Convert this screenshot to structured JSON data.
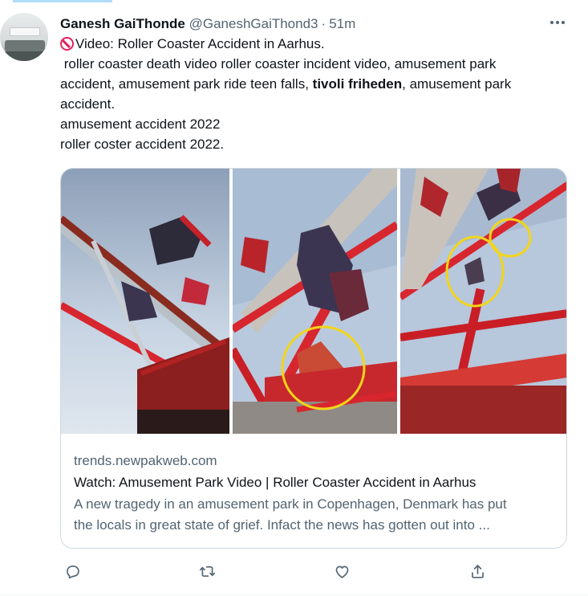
{
  "tweet": {
    "author_name": "Ganesh GaiThonde",
    "handle": "@GaneshGaiThond3",
    "separator": "·",
    "time": "51m",
    "text_line1": "Video: Roller Coaster Accident in Aarhus.",
    "text_line2a": " roller coaster death video roller coaster incident video, amusement park",
    "text_line3a": "accident, amusement park ride teen falls, ",
    "text_bold": "tivoli friheden",
    "text_line3b": ", amusement park",
    "text_line4": "accident.",
    "text_line5": "amusement accident 2022",
    "text_line6": "roller coster accident 2022."
  },
  "card": {
    "domain": "trends.newpakweb.com",
    "title": "Watch: Amusement Park Video | Roller Coaster Accident in Aarhus",
    "description_line1": "A new tragedy in an amusement park in Copenhagen, Denmark has put",
    "description_line2": "the locals in great state of grief. Infact the news has gotten out into ..."
  },
  "colors": {
    "accent": "#1d9bf0",
    "secondary_text": "#536471",
    "primary_text": "#0f1419",
    "border": "#cfd9de",
    "no_entry": "#e0245e",
    "highlight_circle": "#f2d51a",
    "ride_red": "#d8262e"
  },
  "icons": {
    "header": [
      "more-horizontal-icon"
    ],
    "text": [
      "no-entry-icon"
    ],
    "actions": [
      "reply-icon",
      "retweet-icon",
      "like-icon",
      "share-icon"
    ]
  }
}
